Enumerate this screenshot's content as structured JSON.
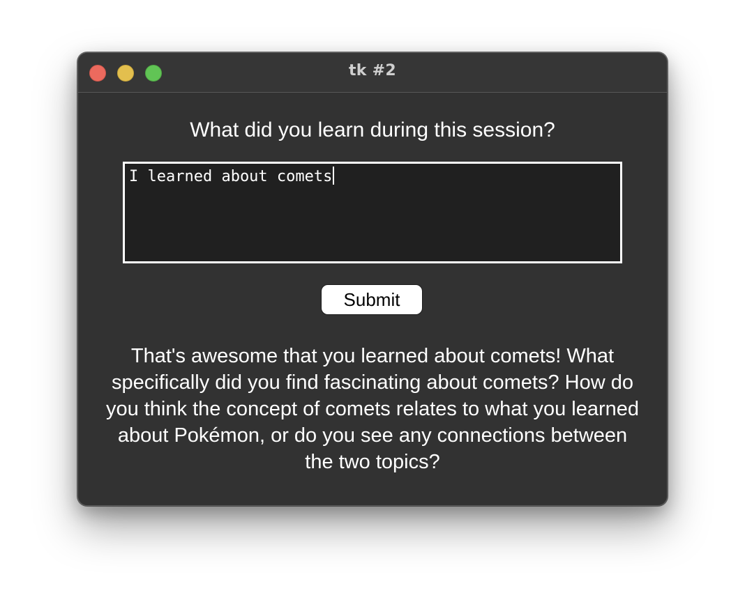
{
  "window": {
    "title": "tk #2",
    "controls": {
      "close_color": "#ec6a5e",
      "minimize_color": "#e3bf4e",
      "zoom_color": "#61c455"
    }
  },
  "form": {
    "question": "What did you learn during this session?",
    "answer_value": "I learned about comets",
    "submit_label": "Submit"
  },
  "response": {
    "lines": [
      "That's awesome that you learned about comets! What",
      "specifically did you find fascinating about comets? How do",
      "you think the concept of comets relates to what you learned",
      "about Pokémon, or do you see any connections between",
      "the two topics?"
    ]
  }
}
